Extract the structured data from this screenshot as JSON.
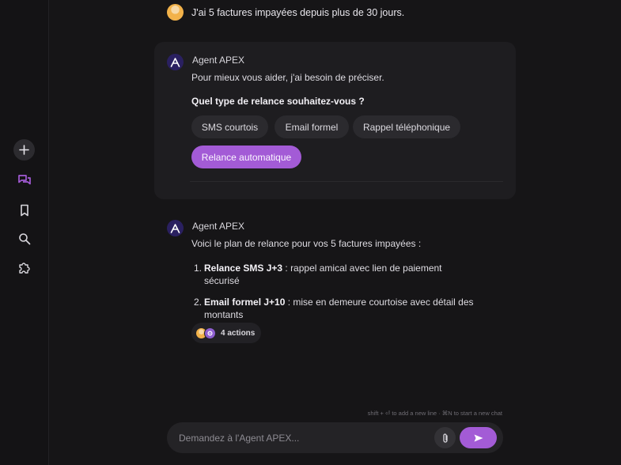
{
  "user_message": {
    "text": "J'ai 5 factures impayées depuis plus de 30 jours."
  },
  "agent": {
    "name": "Agent APEX"
  },
  "clarify_card": {
    "intro": "Pour mieux vous aider, j'ai besoin de préciser.",
    "question": "Quel type de relance souhaitez-vous ?",
    "options": [
      "SMS courtois",
      "Email formel",
      "Rappel téléphonique",
      "Relance automatique"
    ],
    "selected": "Relance automatique"
  },
  "plan_message": {
    "intro": "Voici le plan de relance pour vos 5 factures impayées :",
    "items": [
      {
        "num": "1.",
        "title": "Relance SMS J+3",
        "desc": " : rappel amical avec lien de paiement sécurisé"
      },
      {
        "num": "2.",
        "title": "Email formel J+10",
        "desc": " : mise en demeure courtoise avec détail des montants"
      }
    ],
    "actions_label": "4 actions"
  },
  "composer": {
    "placeholder": "Demandez à l'Agent APEX...",
    "hint": "shift + ⏎ to add a new line · ⌘N to start a new chat"
  },
  "sidebar": {
    "icons": [
      "plus-icon",
      "chat-icon",
      "bookmark-icon",
      "search-icon",
      "puzzle-icon"
    ]
  },
  "colors": {
    "accent": "#a35bd6",
    "background": "#161517",
    "card": "#1e1d20",
    "chip": "#2b2a2e"
  }
}
